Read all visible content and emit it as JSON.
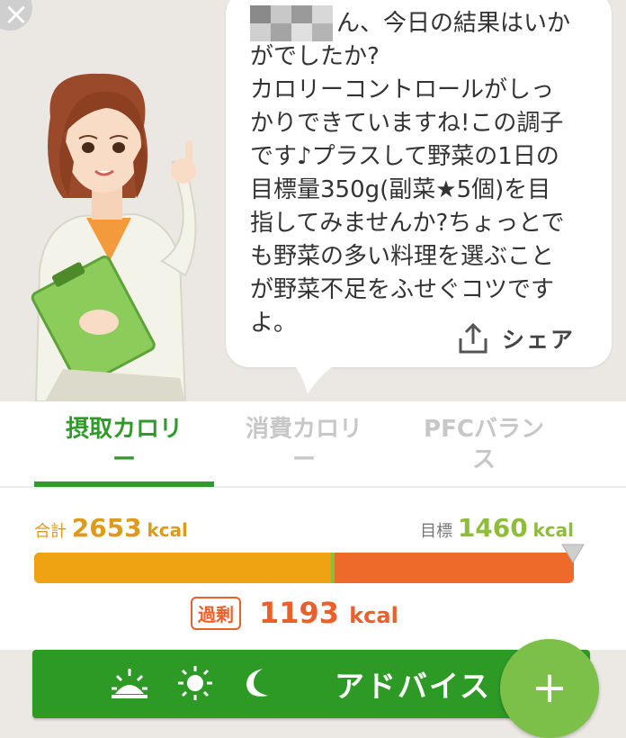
{
  "close": {
    "icon": "close-icon",
    "glyph": "×"
  },
  "message": {
    "text": "ん、今日の結果はいか\nがでしたか?\nカロリーコントロールがしっ\nかりできていますね!この調子\nです♪プラスして野菜の1日の\n目標量350g(副菜★5個)を目\n指してみませんか?ちょっとで\nも野菜の多い料理を選ぶこと\nが野菜不足をふせぐコツです\nよ。",
    "share_label": "シェア",
    "share_icon": "share-icon"
  },
  "tabs": [
    {
      "label": "摂取カロリ\nー",
      "active": true
    },
    {
      "label": "消費カロリ\nー",
      "active": false
    },
    {
      "label": "PFCバラン\nス",
      "active": false
    }
  ],
  "summary": {
    "total_label": "合計",
    "total_value": "2653",
    "total_unit": "kcal",
    "target_label": "目標",
    "target_value": "1460",
    "target_unit": "kcal",
    "intake_fraction": 0.92,
    "target_fraction": 0.55,
    "excess_label": "過剰",
    "excess_value": "1193",
    "excess_unit": "kcal"
  },
  "colors": {
    "accent_green": "#2e9a26",
    "intake_orange": "#f0a312",
    "excess_orange": "#ea5f2a",
    "target_green": "#8fbd3a"
  },
  "advice": {
    "label": "アドバイス",
    "icons": [
      "sunrise-icon",
      "sun-icon",
      "moon-icon"
    ]
  },
  "fab": {
    "icon": "plus-icon",
    "glyph": "+"
  }
}
